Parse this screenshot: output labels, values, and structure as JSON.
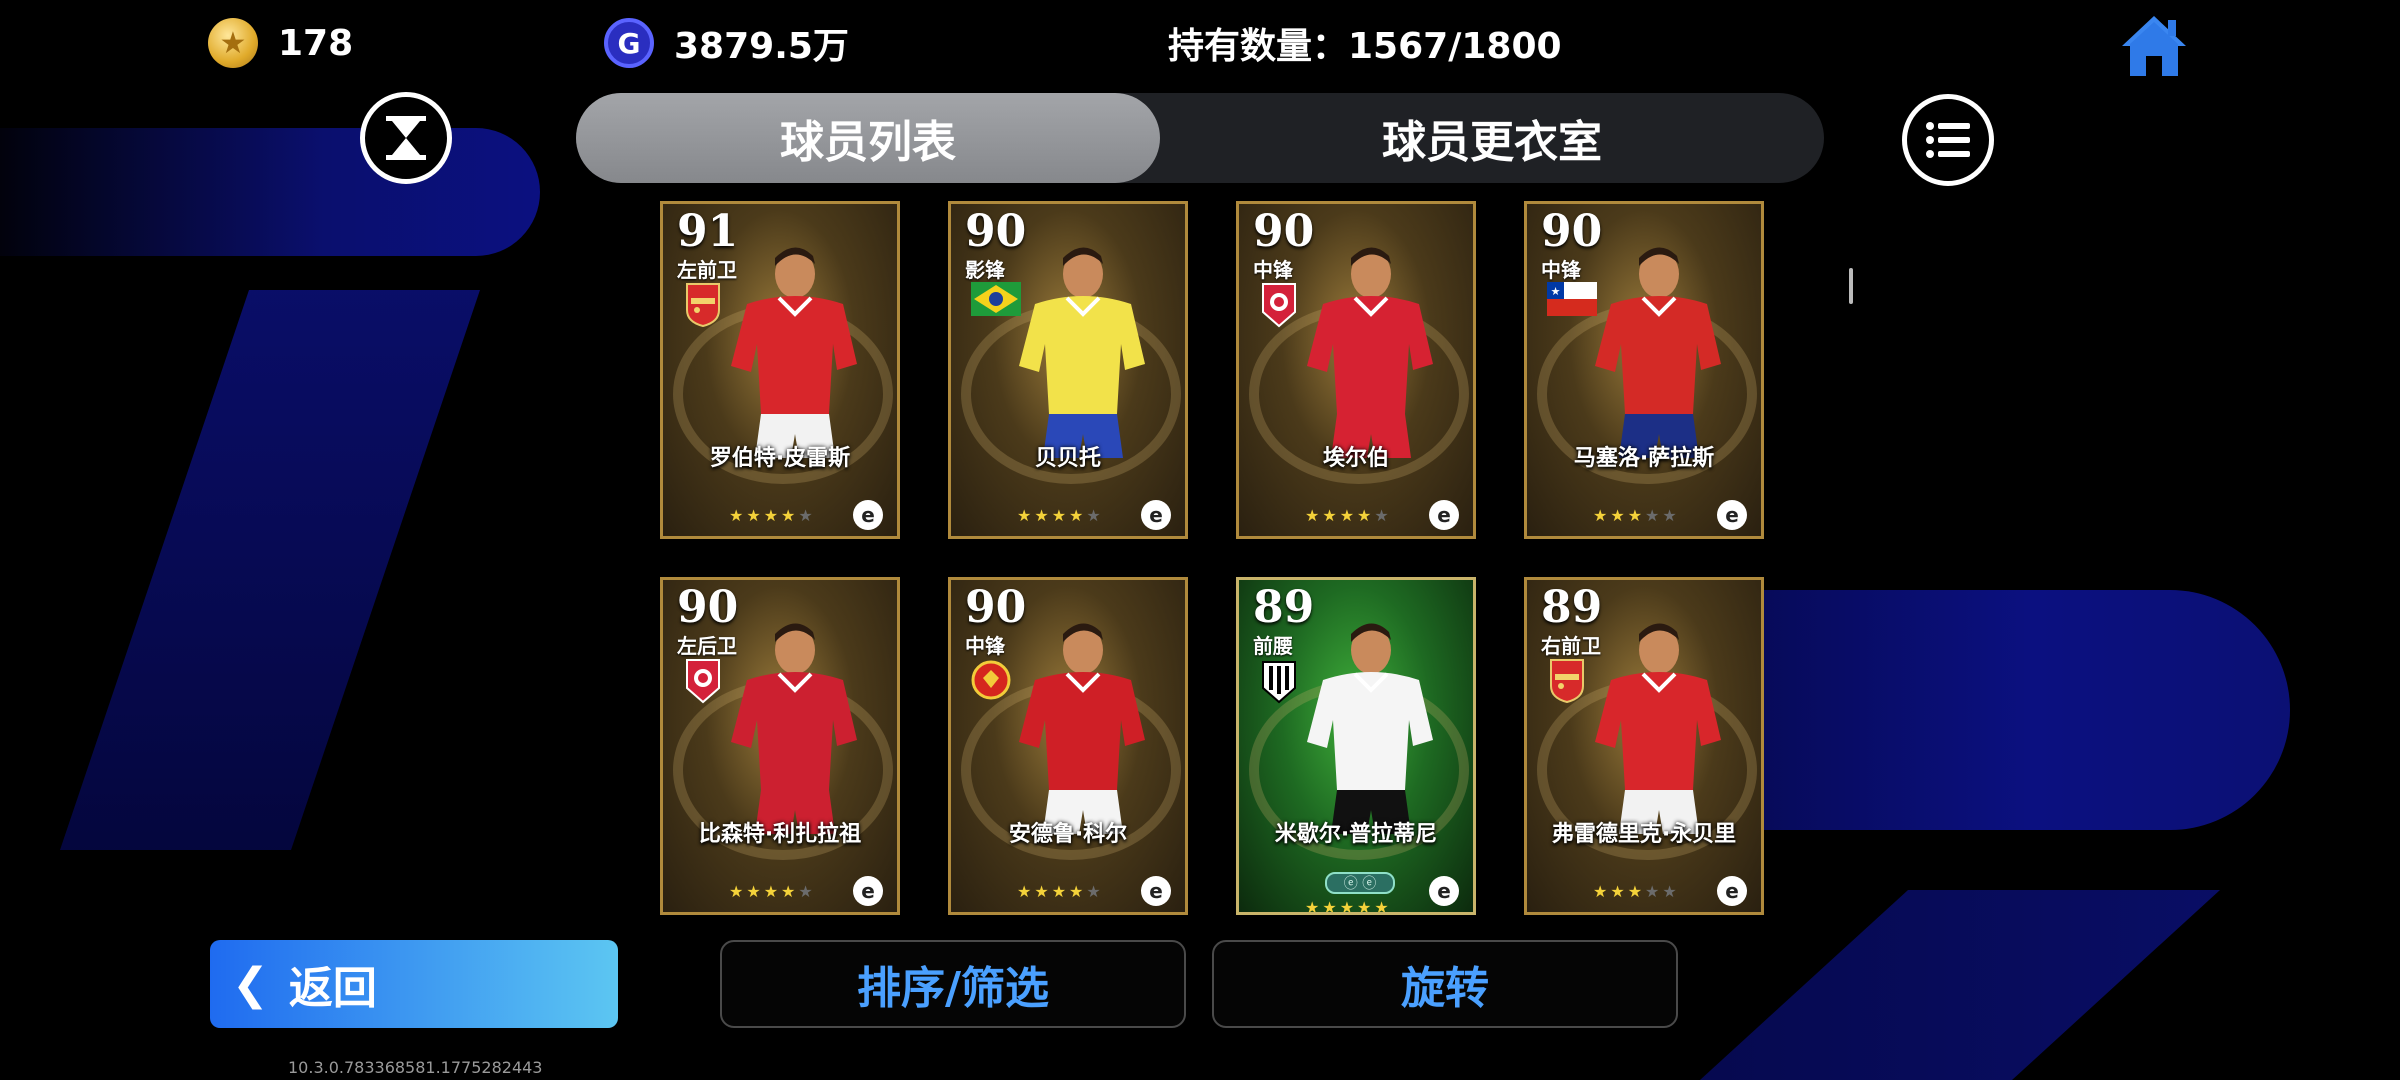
{
  "topbar": {
    "coins": "178",
    "gp": "3879.5万",
    "gp_icon_letter": "G",
    "holdings": "持有数量：1567/1800"
  },
  "tabs": [
    {
      "label": "球员列表",
      "active": true
    },
    {
      "label": "球员更衣室",
      "active": false
    }
  ],
  "cards": [
    {
      "rating": "91",
      "position": "左前卫",
      "name": "罗伯特·皮雷斯",
      "stars": 4,
      "badge": "arsenal-crest",
      "theme": "gold",
      "kit": "#d8262b",
      "shorts": "#f2f2f2"
    },
    {
      "rating": "90",
      "position": "影锋",
      "name": "贝贝托",
      "stars": 4,
      "badge": "brazil-flag",
      "theme": "gold",
      "kit": "#f2e24a",
      "shorts": "#2a48b8"
    },
    {
      "rating": "90",
      "position": "中锋",
      "name": "埃尔伯",
      "stars": 4,
      "badge": "bayern-crest",
      "theme": "gold",
      "kit": "#d62232",
      "shorts": "#d62232"
    },
    {
      "rating": "90",
      "position": "中锋",
      "name": "马塞洛·萨拉斯",
      "stars": 3,
      "badge": "chile-flag",
      "theme": "gold",
      "kit": "#d42a26",
      "shorts": "#1c2f86"
    },
    {
      "rating": "90",
      "position": "左后卫",
      "name": "比森特·利扎拉祖",
      "stars": 4,
      "badge": "bayern-crest",
      "theme": "gold",
      "kit": "#cc2030",
      "shorts": "#cc2030"
    },
    {
      "rating": "90",
      "position": "中锋",
      "name": "安德鲁·科尔",
      "stars": 4,
      "badge": "man-utd-crest",
      "theme": "gold",
      "kit": "#cf1f26",
      "shorts": "#f4f4f4"
    },
    {
      "rating": "89",
      "position": "前腰",
      "name": "米歇尔·普拉蒂尼",
      "stars": 5,
      "badge": "juventus-crest",
      "theme": "green",
      "kit": "#f5f5f5",
      "shorts": "#111111"
    },
    {
      "rating": "89",
      "position": "右前卫",
      "name": "弗雷德里克·永贝里",
      "stars": 3,
      "badge": "arsenal-crest",
      "theme": "gold",
      "kit": "#d8262b",
      "shorts": "#f2f2f2"
    }
  ],
  "buttons": {
    "back": "返回",
    "sort_filter": "排序/筛选",
    "rotate": "旋转"
  },
  "version": "10.3.0.783368581.1775282443",
  "colors": {
    "accent_blue": "#4aa0ff",
    "tab_active": "#96989c",
    "card_border_gold": "#b08a3c",
    "card_bg_green": "#1e6a22"
  },
  "icons": {
    "coin": "star-coin-icon",
    "gp": "gp-icon",
    "home": "home-icon",
    "hourglass": "hourglass-icon",
    "menu": "list-menu-icon",
    "back": "chevron-left-icon"
  }
}
